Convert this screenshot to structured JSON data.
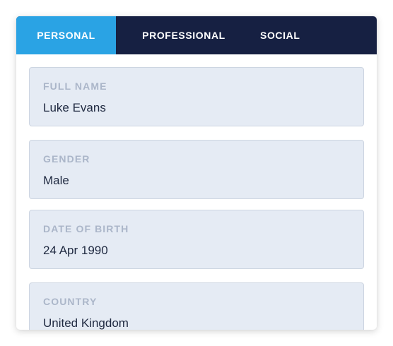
{
  "tabs": [
    {
      "label": "PERSONAL",
      "active": true
    },
    {
      "label": "PROFESSIONAL",
      "active": false
    },
    {
      "label": "SOCIAL",
      "active": false
    }
  ],
  "fields": [
    {
      "label": "FULL NAME",
      "value": "Luke Evans"
    },
    {
      "label": "GENDER",
      "value": "Male"
    },
    {
      "label": "DATE OF BIRTH",
      "value": "24 Apr 1990"
    },
    {
      "label": "COUNTRY",
      "value": "United Kingdom"
    }
  ],
  "colors": {
    "tabbar_bg": "#162042",
    "active_tab_bg": "#2aa3e4",
    "field_bg": "#e5ebf4",
    "label_color": "#abb6c9",
    "value_color": "#1f2940"
  }
}
